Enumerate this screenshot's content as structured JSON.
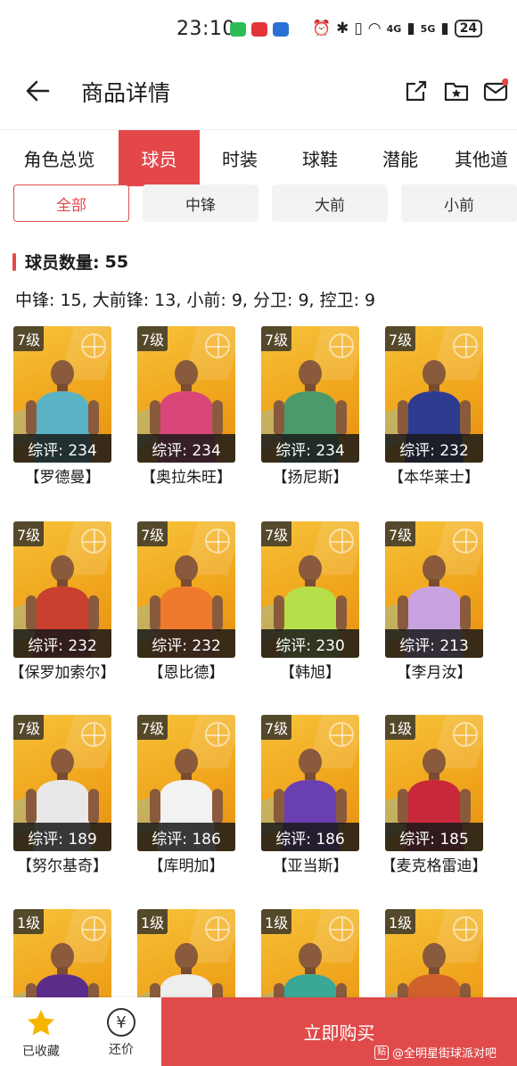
{
  "status": {
    "time": "23:10",
    "sig1": "4G",
    "sig2": "5G",
    "battery": "24"
  },
  "header": {
    "title": "商品详情"
  },
  "tabs": [
    "角色总览",
    "球员",
    "时装",
    "球鞋",
    "潜能",
    "其他道"
  ],
  "filters": [
    "全部",
    "中锋",
    "大前",
    "小前"
  ],
  "count": {
    "label": "球员数量:",
    "value": "55"
  },
  "breakdown": "中锋: 15, 大前锋: 13, 小前: 9, 分卫: 9, 控卫: 9",
  "players": [
    {
      "level": "7级",
      "rating": "综评: 234",
      "name": "【罗德曼】",
      "jersey": "#5ab3c4"
    },
    {
      "level": "7级",
      "rating": "综评: 234",
      "name": "【奥拉朱旺】",
      "jersey": "#d9477a"
    },
    {
      "level": "7级",
      "rating": "综评: 234",
      "name": "【扬尼斯】",
      "jersey": "#4b9a6a"
    },
    {
      "level": "7级",
      "rating": "综评: 232",
      "name": "【本华莱士】",
      "jersey": "#2e3c8f"
    },
    {
      "level": "7级",
      "rating": "综评: 232",
      "name": "【保罗加索尔】",
      "jersey": "#c9402f"
    },
    {
      "level": "7级",
      "rating": "综评: 232",
      "name": "【恩比德】",
      "jersey": "#f07a2b"
    },
    {
      "level": "7级",
      "rating": "综评: 230",
      "name": "【韩旭】",
      "jersey": "#b7df4a"
    },
    {
      "level": "7级",
      "rating": "综评: 213",
      "name": "【李月汝】",
      "jersey": "#c9a3e0"
    },
    {
      "level": "7级",
      "rating": "综评: 189",
      "name": "【努尔基奇】",
      "jersey": "#e8e8e8"
    },
    {
      "level": "7级",
      "rating": "综评: 186",
      "name": "【库明加】",
      "jersey": "#f2f2f2"
    },
    {
      "level": "7级",
      "rating": "综评: 186",
      "name": "【亚当斯】",
      "jersey": "#6a3fb2"
    },
    {
      "level": "1级",
      "rating": "综评: 185",
      "name": "【麦克格雷迪】",
      "jersey": "#c8283a"
    },
    {
      "level": "1级",
      "rating": "",
      "name": "",
      "jersey": "#5a2d8a"
    },
    {
      "level": "1级",
      "rating": "",
      "name": "",
      "jersey": "#eeeeee"
    },
    {
      "level": "1级",
      "rating": "",
      "name": "",
      "jersey": "#3aa896"
    },
    {
      "level": "1级",
      "rating": "",
      "name": "",
      "jersey": "#d0612a"
    }
  ],
  "bottom": {
    "fav_label": "已收藏",
    "bargain_label": "还价",
    "bargain_glyph": "¥",
    "buy_label": "立即购买",
    "watermark": "@全明星街球派对吧",
    "watermark_badge": "贴"
  },
  "colors": {
    "accent": "#e3474a",
    "card": "#f0a51c"
  }
}
